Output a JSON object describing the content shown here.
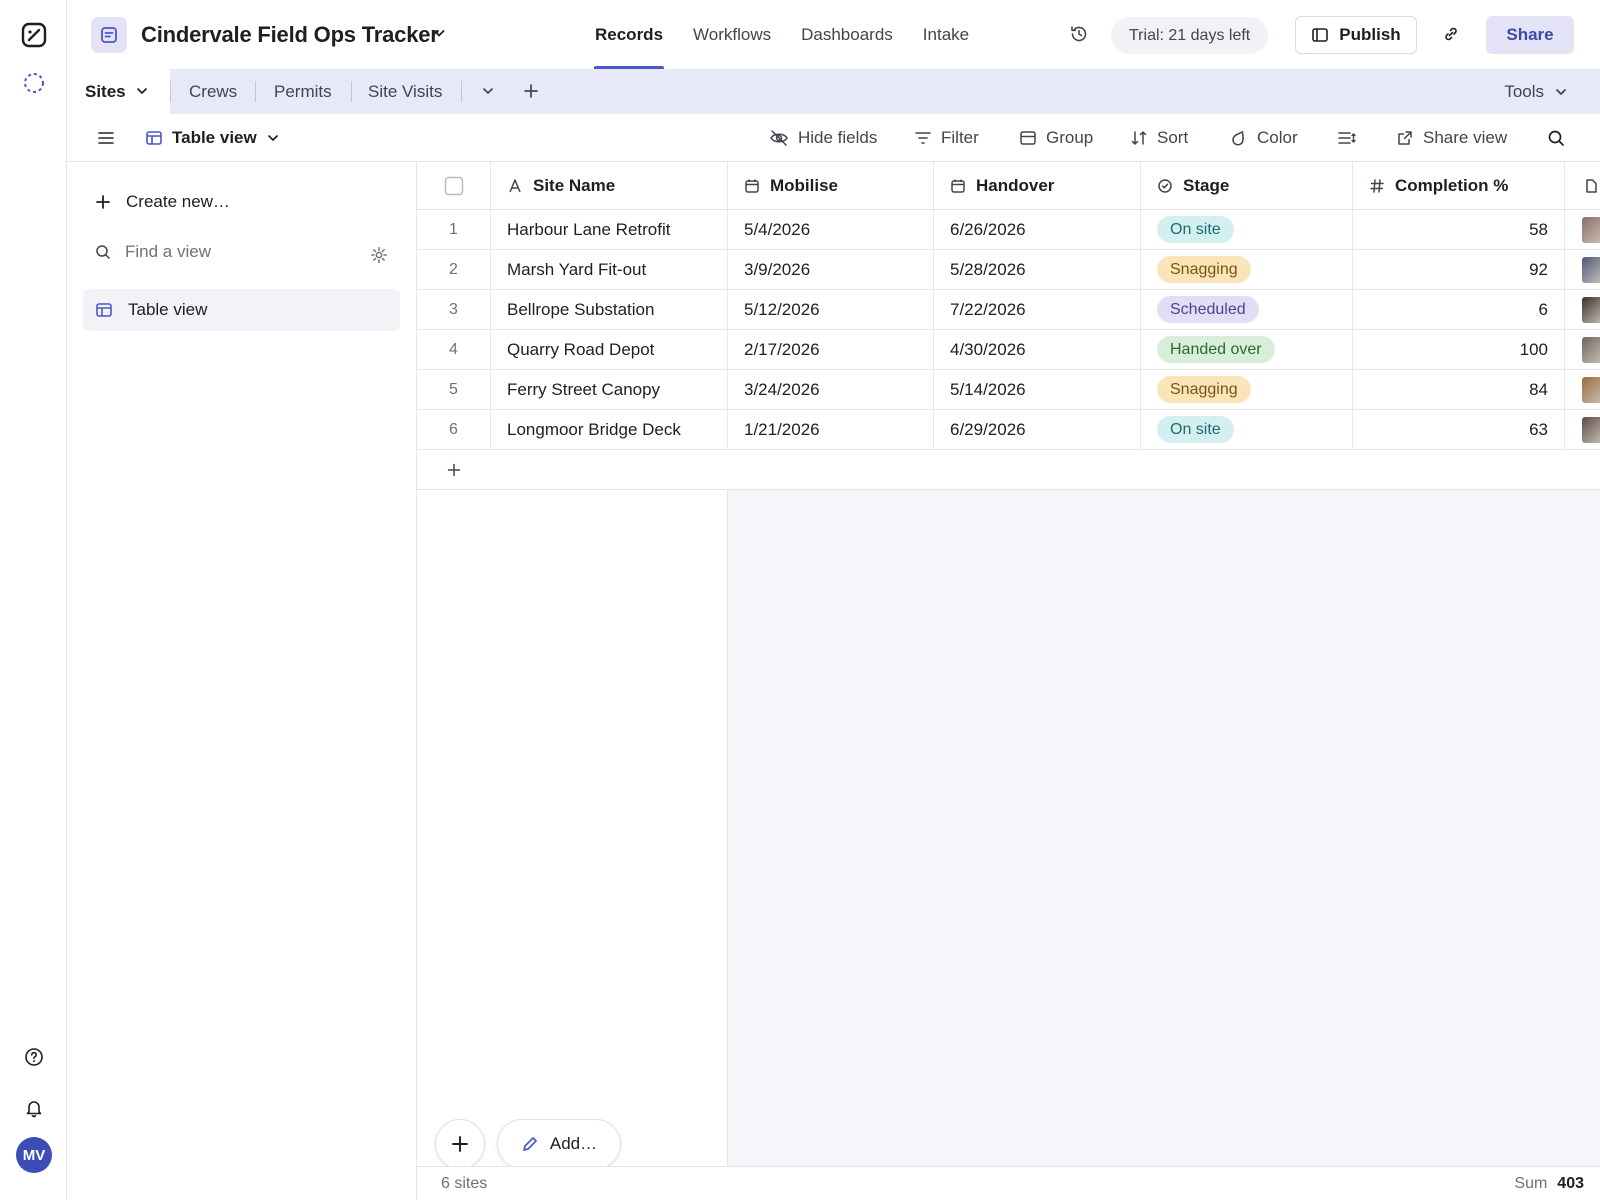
{
  "app": {
    "title": "Cindervale Field Ops Tracker",
    "nav_tabs": [
      {
        "label": "Records",
        "active": true
      },
      {
        "label": "Workflows"
      },
      {
        "label": "Dashboards"
      },
      {
        "label": "Intake"
      }
    ],
    "trial_label": "Trial: 21 days left",
    "publish_label": "Publish",
    "share_label": "Share"
  },
  "tables": {
    "active": "Sites",
    "others": [
      "Crews",
      "Permits",
      "Site Visits"
    ],
    "tools_label": "Tools"
  },
  "toolbar": {
    "view_name": "Table view",
    "hide_fields": "Hide fields",
    "filter": "Filter",
    "group": "Group",
    "sort": "Sort",
    "color": "Color",
    "share_view": "Share view"
  },
  "sidebar": {
    "create_new": "Create new…",
    "find_placeholder": "Find a view",
    "views": [
      "Table view"
    ]
  },
  "grid": {
    "columns": [
      {
        "label": "Site Name",
        "icon": "text-field-icon"
      },
      {
        "label": "Mobilise",
        "icon": "calendar-icon"
      },
      {
        "label": "Handover",
        "icon": "calendar-icon"
      },
      {
        "label": "Stage",
        "icon": "status-icon"
      },
      {
        "label": "Completion %",
        "icon": "hash-icon"
      }
    ],
    "rows": [
      {
        "n": "1",
        "name": "Harbour Lane Retrofit",
        "mobilise": "5/4/2026",
        "handover": "6/26/2026",
        "stage": "On site",
        "completion": "58"
      },
      {
        "n": "2",
        "name": "Marsh Yard Fit-out",
        "mobilise": "3/9/2026",
        "handover": "5/28/2026",
        "stage": "Snagging",
        "completion": "92"
      },
      {
        "n": "3",
        "name": "Bellrope Substation",
        "mobilise": "5/12/2026",
        "handover": "7/22/2026",
        "stage": "Scheduled",
        "completion": "6"
      },
      {
        "n": "4",
        "name": "Quarry Road Depot",
        "mobilise": "2/17/2026",
        "handover": "4/30/2026",
        "stage": "Handed over",
        "completion": "100"
      },
      {
        "n": "5",
        "name": "Ferry Street Canopy",
        "mobilise": "3/24/2026",
        "handover": "5/14/2026",
        "stage": "Snagging",
        "completion": "84"
      },
      {
        "n": "6",
        "name": "Longmoor Bridge Deck",
        "mobilise": "1/21/2026",
        "handover": "6/29/2026",
        "stage": "On site",
        "completion": "63"
      }
    ],
    "stage_colors": {
      "On site": {
        "bg": "#d4eff0",
        "fg": "#1d6b6e"
      },
      "Snagging": {
        "bg": "#fbe4b8",
        "fg": "#7a5412"
      },
      "Scheduled": {
        "bg": "#e3def5",
        "fg": "#4d4196"
      },
      "Handed over": {
        "bg": "#d8eed8",
        "fg": "#2b6a2e"
      }
    }
  },
  "fab": {
    "add_label": "Add…"
  },
  "footer": {
    "count": "6 sites",
    "sum_label": "Sum",
    "sum_value": "403"
  },
  "user": {
    "initials": "MV"
  }
}
